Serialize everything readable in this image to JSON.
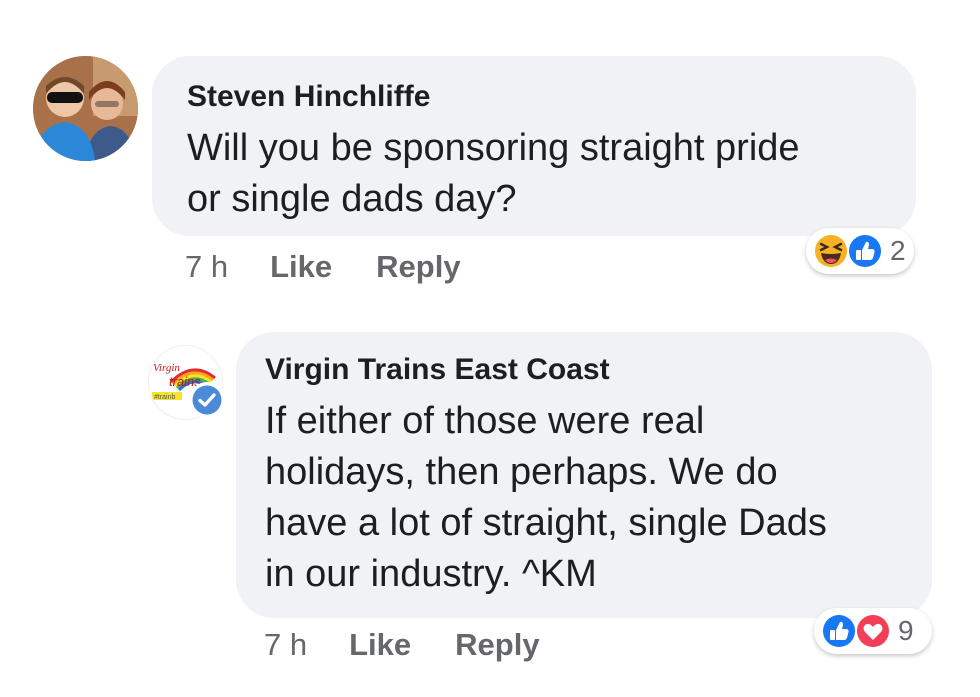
{
  "comments": [
    {
      "author": "Steven Hinchliffe",
      "text": "Will you be sponsoring straight pride\nor single dads day?",
      "time": "7 h",
      "like_label": "Like",
      "reply_label": "Reply",
      "reactions": {
        "icons": [
          "haha-icon",
          "like-icon"
        ],
        "count": "2"
      }
    },
    {
      "author": "Virgin Trains East Coast",
      "text": "If either of those were real\nholidays, then perhaps. We do\nhave a lot of straight, single Dads\nin our industry. ^KM",
      "time": "7 h",
      "like_label": "Like",
      "reply_label": "Reply",
      "reactions": {
        "icons": [
          "like-icon",
          "love-icon"
        ],
        "count": "9"
      },
      "verified": true,
      "avatar_logo": {
        "brand": "Virgin",
        "word": "trains",
        "tag": "#trainb"
      }
    }
  ],
  "colors": {
    "bubble": "#f0f2f5",
    "like_blue": "#1877f2",
    "love_red": "#f33e58",
    "haha_yellow": "#f7b125",
    "meta_gray": "#65676b"
  }
}
